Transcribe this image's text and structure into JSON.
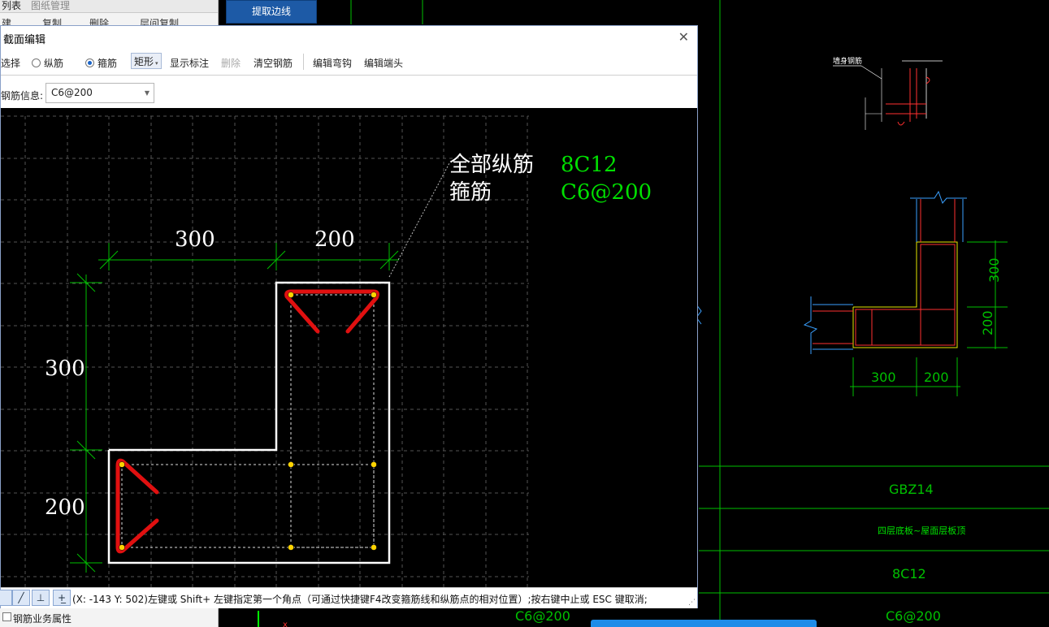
{
  "app": {
    "tabs": [
      "列表",
      "图纸管理"
    ],
    "toolbar_items": [
      "建",
      "复制",
      "删除",
      "层间复制"
    ],
    "extract_button": "提取边线",
    "bottom_property": "钢筋业务属性"
  },
  "dialog": {
    "title": "截面编辑",
    "toolbar": {
      "select": "选择",
      "longitudinal": "纵筋",
      "stirrup": "箍筋",
      "shape": "矩形",
      "show_annotation": "显示标注",
      "delete": "删除",
      "clear_rebar": "清空钢筋",
      "edit_hook": "编辑弯钩",
      "edit_end": "编辑端头"
    },
    "info_label": "钢筋信息:",
    "rebar_value": "C6@200",
    "canvas": {
      "legend_all_long_label": "全部纵筋",
      "legend_all_long_value": "8C12",
      "legend_stirrup_label": "箍筋",
      "legend_stirrup_value": "C6@200",
      "dim_top_1": "300",
      "dim_top_2": "200",
      "dim_left_1": "300",
      "dim_left_2": "200"
    },
    "status_text": "(X: -143 Y: 502)左键或 Shift+ 左键指定第一个角点（可通过快捷键F4改变箍筋线和纵筋点的相对位置）;按右键中止或 ESC 键取消;"
  },
  "drawing": {
    "detail_label": "墙身钢筋",
    "dim_vertical_1": "300",
    "dim_vertical_2": "200",
    "dim_horizontal_1": "300",
    "dim_horizontal_2": "200",
    "table": {
      "name": "GBZ14",
      "elevation": "四层底板~屋面层板顶",
      "longitudinal": "8C12",
      "stirrup": "C6@200"
    },
    "bottom_stirrup": "C6@200"
  }
}
